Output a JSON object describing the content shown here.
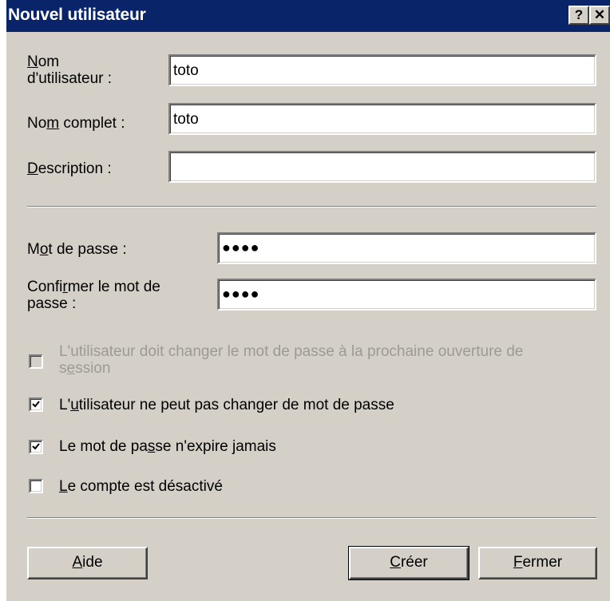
{
  "window": {
    "title": "Nouvel utilisateur",
    "help_glyph": "?",
    "close_glyph": "✕"
  },
  "fields": {
    "username": {
      "label_pre": "",
      "label_u": "N",
      "label_post": "om",
      "label_line2": "d'utilisateur :",
      "value": "toto"
    },
    "fullname": {
      "label_pre": "No",
      "label_u": "m",
      "label_post": " complet :",
      "value": "toto"
    },
    "description": {
      "label_pre": "",
      "label_u": "D",
      "label_post": "escription :",
      "value": ""
    },
    "password": {
      "label_pre": "M",
      "label_u": "o",
      "label_post": "t de passe :",
      "value": "●●●●"
    },
    "confirm": {
      "label_pre": "Confi",
      "label_u": "r",
      "label_post": "mer le mot de",
      "label_line2": "passe :",
      "value": "●●●●"
    }
  },
  "checkboxes": {
    "must_change": {
      "line1": "L'utilisateur doit changer le mot de passe à la prochaine ouverture de",
      "line2_pre": "s",
      "line2_u": "e",
      "line2_post": "ssion",
      "checked": false,
      "disabled": true
    },
    "cannot_change": {
      "pre": "L'",
      "u": "u",
      "post": "tilisateur ne peut pas changer de mot de passe",
      "checked": true
    },
    "never_expires": {
      "pre": "Le mot de pa",
      "u": "s",
      "post": "se n'expire jamais",
      "checked": true
    },
    "disabled_account": {
      "pre": "",
      "u": "L",
      "post": "e compte est désactivé",
      "checked": false
    }
  },
  "buttons": {
    "help": {
      "pre": "",
      "u": "A",
      "post": "ide"
    },
    "create": {
      "pre": "",
      "u": "C",
      "post": "réer"
    },
    "close": {
      "pre": "",
      "u": "F",
      "post": "ermer"
    }
  },
  "colors": {
    "titlebar": "#0a246a",
    "dialog_bg": "#d4d0c8",
    "disabled_text": "#9c9a94"
  }
}
